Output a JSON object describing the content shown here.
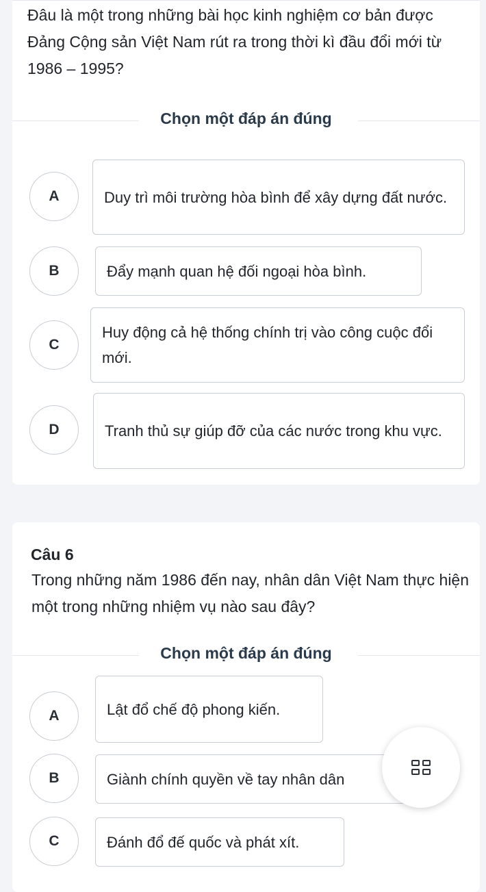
{
  "q1": {
    "text": "Đâu là một trong những bài học kinh nghiệm cơ bản được Đảng Cộng sản Việt Nam rút ra trong thời kì đầu đổi mới từ 1986 – 1995?",
    "prompt": "Chọn một đáp án đúng",
    "options": [
      {
        "letter": "A",
        "text": "Duy trì môi trường hòa bình để xây dựng đất nước."
      },
      {
        "letter": "B",
        "text": "Đẩy mạnh quan hệ đối ngoại hòa bình."
      },
      {
        "letter": "C",
        "text": "Huy động cả hệ thống chính trị vào công cuộc đổi mới."
      },
      {
        "letter": "D",
        "text": "Tranh thủ sự giúp đỡ của các nước trong khu vực."
      }
    ]
  },
  "q2": {
    "number": "Câu 6",
    "text": "Trong những năm 1986 đến nay, nhân dân Việt Nam thực hiện một trong những nhiệm vụ nào sau đây?",
    "prompt": "Chọn một đáp án đúng",
    "options": [
      {
        "letter": "A",
        "text": "Lật đổ chế độ phong kiến."
      },
      {
        "letter": "B",
        "text": "Giành chính quyền về tay nhân dân"
      },
      {
        "letter": "C",
        "text": "Đánh đổ đế quốc và phát xít."
      }
    ]
  },
  "fab": {
    "icon": "grid-icon"
  }
}
